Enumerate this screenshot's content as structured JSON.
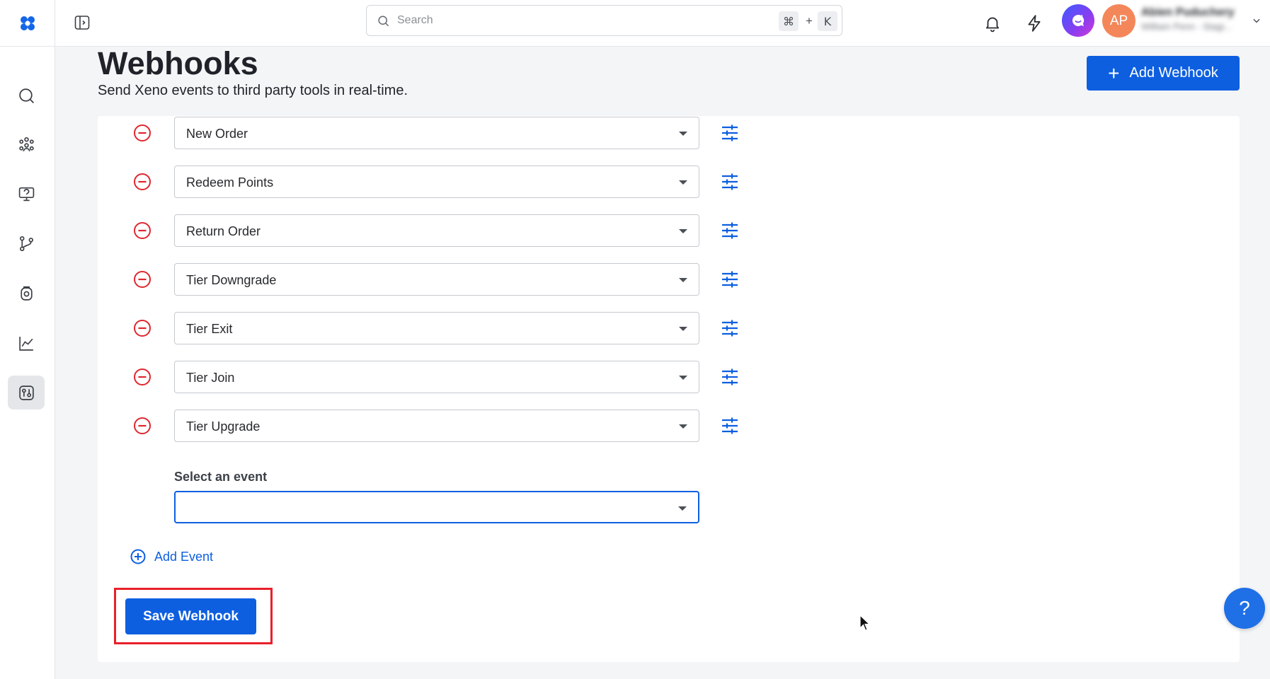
{
  "topbar": {
    "search_placeholder": "Search",
    "shortcut_cmd": "⌘",
    "shortcut_plus": "+",
    "shortcut_key": "K",
    "avatar_initials": "AP",
    "user_name": "Abien Puduchery",
    "user_org": "William Penn - Stagi..."
  },
  "sidebar": {
    "items": [
      {
        "icon": "search-icon"
      },
      {
        "icon": "audience-icon"
      },
      {
        "icon": "campaigns-icon"
      },
      {
        "icon": "journeys-icon"
      },
      {
        "icon": "loyalty-icon"
      },
      {
        "icon": "analytics-icon"
      },
      {
        "icon": "integrations-icon",
        "active": true
      }
    ]
  },
  "header": {
    "title": "Webhooks",
    "subtitle": "Send Xeno events to third party tools in real-time.",
    "add_button_plus": "+",
    "add_button_label": "Add Webhook"
  },
  "events": [
    {
      "value": "New Order"
    },
    {
      "value": "Redeem Points"
    },
    {
      "value": "Return Order"
    },
    {
      "value": "Tier Downgrade"
    },
    {
      "value": "Tier Exit"
    },
    {
      "value": "Tier Join"
    },
    {
      "value": "Tier Upgrade"
    }
  ],
  "new_event": {
    "label": "Select an event",
    "value": ""
  },
  "add_event_label": "Add Event",
  "save_label": "Save Webhook",
  "help_label": "?",
  "colors": {
    "primary": "#0d5fe0",
    "danger": "#e0262e",
    "highlight": "#e8202a",
    "avatar": "#f4875a"
  }
}
